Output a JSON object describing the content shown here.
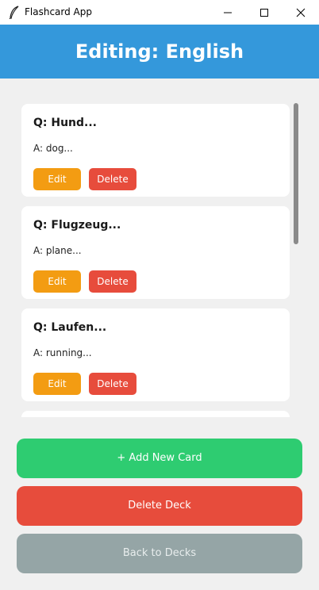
{
  "window": {
    "title": "Flashcard App",
    "icon": "feather-icon"
  },
  "header": {
    "title": "Editing: English",
    "bg_color": "#3498db"
  },
  "cards": [
    {
      "question": "Q: Hund...",
      "answer": "A: dog...",
      "edit_label": "Edit",
      "delete_label": "Delete"
    },
    {
      "question": "Q: Flugzeug...",
      "answer": "A: plane...",
      "edit_label": "Edit",
      "delete_label": "Delete"
    },
    {
      "question": "Q: Laufen...",
      "answer": "A: running...",
      "edit_label": "Edit",
      "delete_label": "Delete"
    }
  ],
  "actions": {
    "add_label": "+ Add New Card",
    "delete_deck_label": "Delete Deck",
    "back_label": "Back to Decks"
  },
  "colors": {
    "edit": "#f39c12",
    "delete": "#e74c3c",
    "add": "#2ecc71",
    "back": "#95a5a6"
  }
}
